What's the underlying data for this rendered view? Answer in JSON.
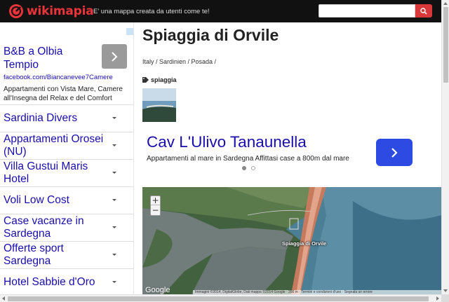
{
  "header": {
    "logo_text": "wikimapia",
    "tagline": "E' una mappa creata da utenti come te!",
    "search_value": "",
    "colors": {
      "brand": "#e8343a",
      "bar": "#111111",
      "search_button": "#d9383a"
    }
  },
  "sidebar": {
    "ad": {
      "title": "B&B a Olbia Tempio",
      "url": "facebook.com/Biancanevee7Camere",
      "description": "Appartamenti con Vista Mare, Camere all'Insegna del Relax e del Comfort"
    },
    "links": [
      {
        "label": "Sardinia Divers"
      },
      {
        "label": "Appartamenti Orosei (NU)"
      },
      {
        "label": "Villa Gustui Maris Hotel"
      },
      {
        "label": "Voli Low Cost"
      },
      {
        "label": "Case vacanze in Sardegna"
      },
      {
        "label": "Offerte sport Sardegna"
      },
      {
        "label": "Hotel Sabbie d'Oro"
      }
    ]
  },
  "main": {
    "title": "Spiaggia di Orvile",
    "breadcrumb": "Italy / Sardinien / Posada /",
    "tag": "spiaggia",
    "ad": {
      "title": "Cav L'Ulivo Tanaunella",
      "description": "Appartamenti al mare in Sardegna Affittasi case a 800m dal mare",
      "active_slide": 1,
      "slide_count": 2,
      "button_color": "#2d4ae3"
    },
    "map": {
      "place_label": "Spiaggia di Orvile",
      "zoom_in": "+",
      "zoom_out": "−",
      "provider": "Google",
      "attribution": "Immagini ©2014, DigitalGlobe, Dati mappa ©2014 Google · 200 m · Termini e condizioni d'uso · Segnala un errore"
    }
  }
}
